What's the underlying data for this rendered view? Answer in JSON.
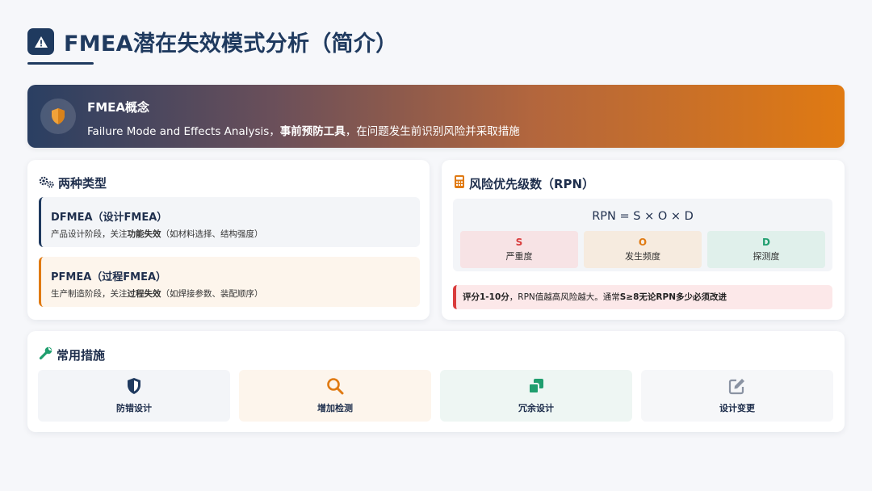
{
  "header": {
    "title": "FMEA潜在失效模式分析（简介）",
    "icon": "warning-icon"
  },
  "banner": {
    "icon": "shield-icon",
    "title": "FMEA概念",
    "desc_prefix": "Failure Mode and Effects Analysis，",
    "desc_bold": "事前预防工具",
    "desc_suffix": "，在问题发生前识别风险并采取措施"
  },
  "types": {
    "icon": "gears-icon",
    "title": "两种类型",
    "items": [
      {
        "title": "DFMEA（设计FMEA）",
        "desc_prefix": "产品设计阶段，关注",
        "desc_bold": "功能失效",
        "desc_suffix": "（如材料选择、结构强度）",
        "accent": "#1f3a5f",
        "bg": "#f3f5f8"
      },
      {
        "title": "PFMEA（过程FMEA）",
        "desc_prefix": "生产制造阶段，关注",
        "desc_bold": "过程失效",
        "desc_suffix": "（如焊接参数、装配顺序）",
        "accent": "#e07a12",
        "bg": "#fdf5ec"
      }
    ]
  },
  "rpn": {
    "icon": "calculator-icon",
    "title": "风险优先级数（RPN）",
    "formula": "RPN = S × O × D",
    "factors": [
      {
        "letter": "S",
        "name": "严重度",
        "color": "#d93c3c",
        "bg": "#f7e3e5"
      },
      {
        "letter": "O",
        "name": "发生频度",
        "color": "#e07a12",
        "bg": "#f6ebdf"
      },
      {
        "letter": "D",
        "name": "探测度",
        "color": "#1f9e6e",
        "bg": "#e0f0eb"
      }
    ],
    "note_bold1": "评分1-10分",
    "note_mid": "，RPN值越高风险越大。通常",
    "note_bold2": "S≥8无论RPN多少必须改进"
  },
  "measures": {
    "icon": "wrench-icon",
    "title": "常用措施",
    "items": [
      {
        "label": "防错设计",
        "icon": "shield-icon",
        "color": "#1f3a5f",
        "bg": "#f3f5f8"
      },
      {
        "label": "增加检测",
        "icon": "search-icon",
        "color": "#e07a12",
        "bg": "#fdf5ec"
      },
      {
        "label": "冗余设计",
        "icon": "copy-icon",
        "color": "#1f9e6e",
        "bg": "#eef6f3"
      },
      {
        "label": "设计变更",
        "icon": "edit-icon",
        "color": "#8a93a3",
        "bg": "#f6f7f9"
      }
    ]
  }
}
